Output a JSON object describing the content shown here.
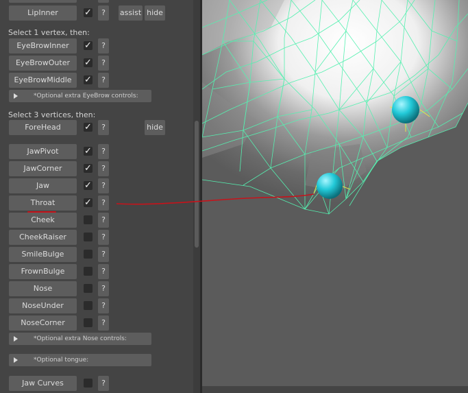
{
  "panel": {
    "lip_inner": {
      "label": "LipInner",
      "checked": "✓",
      "help": "?",
      "assist": "assist",
      "hide": "hide"
    },
    "section1_label": "Select 1 vertex, then:",
    "eyebrow": [
      {
        "label": "EyeBrowInner",
        "checked": "✓",
        "help": "?"
      },
      {
        "label": "EyeBrowOuter",
        "checked": "✓",
        "help": "?"
      },
      {
        "label": "EyeBrowMiddle",
        "checked": "✓",
        "help": "?"
      }
    ],
    "eyebrow_extra": "*Optional extra EyeBrow controls:",
    "section3_label": "Select 3 vertices, then:",
    "forehead": {
      "label": "ForeHead",
      "checked": "✓",
      "help": "?",
      "hide": "hide"
    },
    "controls": [
      {
        "label": "JawPivot",
        "checked": "✓",
        "help": "?"
      },
      {
        "label": "JawCorner",
        "checked": "✓",
        "help": "?"
      },
      {
        "label": "Jaw",
        "checked": "✓",
        "help": "?"
      },
      {
        "label": "Throat",
        "checked": "✓",
        "help": "?"
      },
      {
        "label": "Cheek",
        "checked": "",
        "help": "?"
      },
      {
        "label": "CheekRaiser",
        "checked": "",
        "help": "?"
      },
      {
        "label": "SmileBulge",
        "checked": "",
        "help": "?"
      },
      {
        "label": "FrownBulge",
        "checked": "",
        "help": "?"
      },
      {
        "label": "Nose",
        "checked": "",
        "help": "?"
      },
      {
        "label": "NoseUnder",
        "checked": "",
        "help": "?"
      },
      {
        "label": "NoseCorner",
        "checked": "",
        "help": "?"
      }
    ],
    "nose_extra": "*Optional extra Nose controls:",
    "tongue": "*Optional tongue:",
    "jaw_curves": {
      "label": "Jaw Curves",
      "checked": "",
      "help": "?"
    }
  },
  "colors": {
    "wireframe": "#55f0b0",
    "sphere": "#22c9d8",
    "annotation": "#c8121a"
  }
}
